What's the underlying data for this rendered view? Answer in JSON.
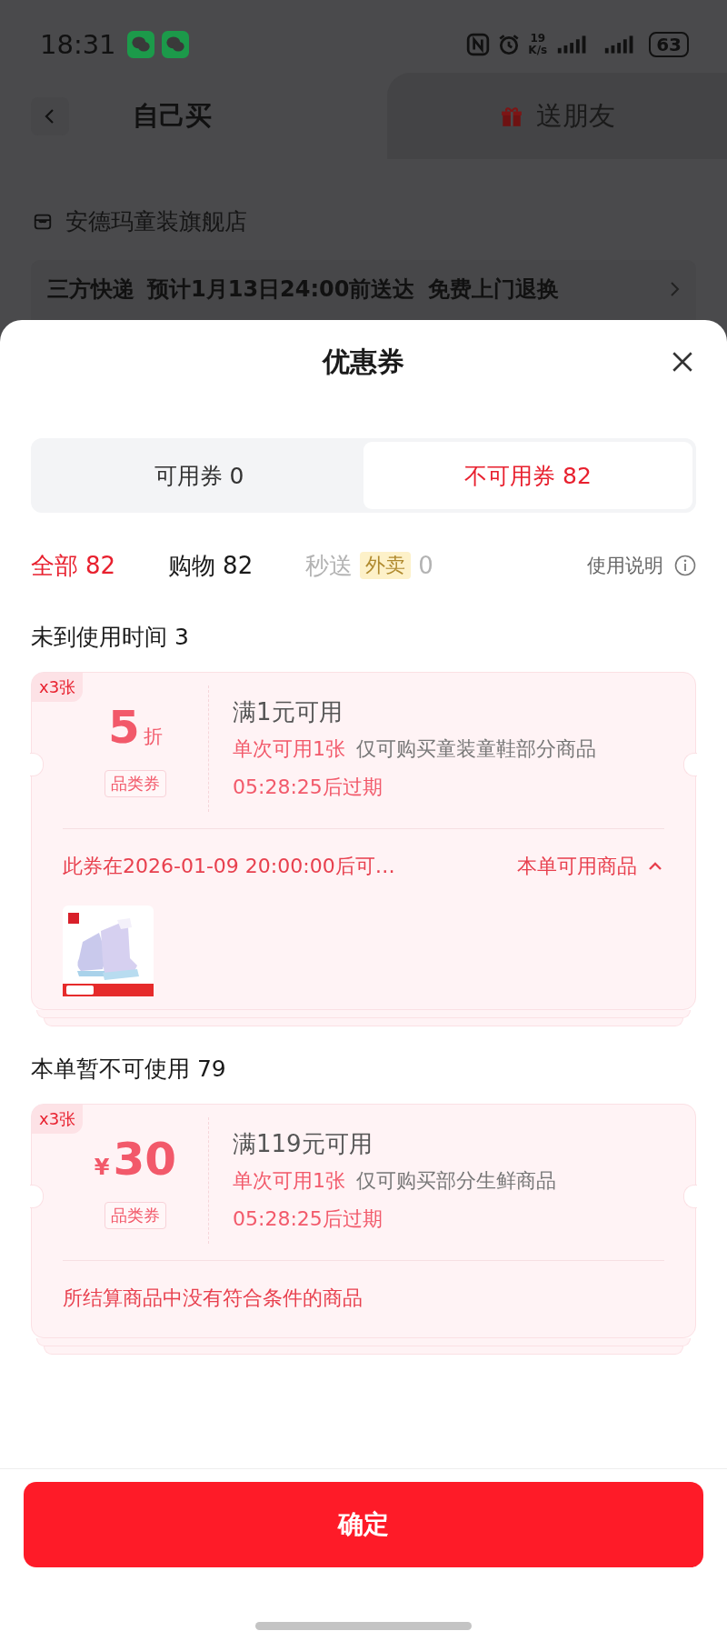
{
  "status_bar": {
    "time": "18:31",
    "net_speed_value": "19",
    "net_speed_unit": "K/s",
    "battery": "63"
  },
  "header": {
    "tabs": [
      {
        "label": "自己买",
        "selected": true
      },
      {
        "label": "送朋友",
        "selected": false
      }
    ]
  },
  "store": {
    "name": "安德玛童装旗舰店"
  },
  "delivery": {
    "carrier": "三方快递",
    "eta": "预计1月13日24:00前送达",
    "service": "免费上门退换"
  },
  "sheet": {
    "title": "优惠券",
    "segments": [
      {
        "label": "可用券 0",
        "selected": false
      },
      {
        "label": "不可用券 82",
        "selected": true
      }
    ],
    "filters": [
      {
        "label": "全部",
        "count": "82",
        "selected": true,
        "disabled": false
      },
      {
        "label": "购物",
        "count": "82",
        "selected": false,
        "disabled": false
      },
      {
        "label": "秒送",
        "tag": "外卖",
        "count": "0",
        "selected": false,
        "disabled": true
      }
    ],
    "help": "使用说明",
    "sections": [
      {
        "title": "未到使用时间 3",
        "coupons": [
          {
            "kind": "discount",
            "quantity": "x3张",
            "value": "5",
            "unit": "折",
            "type_label": "品类券",
            "threshold": "满1元可用",
            "limit": "单次可用1张",
            "scope": "仅可购买童装童鞋部分商品",
            "expiry": "05:28:25后过期",
            "note": "此券在2026-01-09 20:00:00后可…",
            "link": {
              "label": "本单可用商品",
              "expanded": true
            }
          }
        ]
      },
      {
        "title": "本单暂不可使用 79",
        "coupons": [
          {
            "kind": "amount",
            "quantity": "x3张",
            "currency": "¥",
            "value": "30",
            "type_label": "品类券",
            "threshold": "满119元可用",
            "limit": "单次可用1张",
            "scope": "仅可购买部分生鲜商品",
            "expiry": "05:28:25后过期",
            "note": "所结算商品中没有符合条件的商品"
          }
        ]
      }
    ],
    "confirm": "确定"
  }
}
